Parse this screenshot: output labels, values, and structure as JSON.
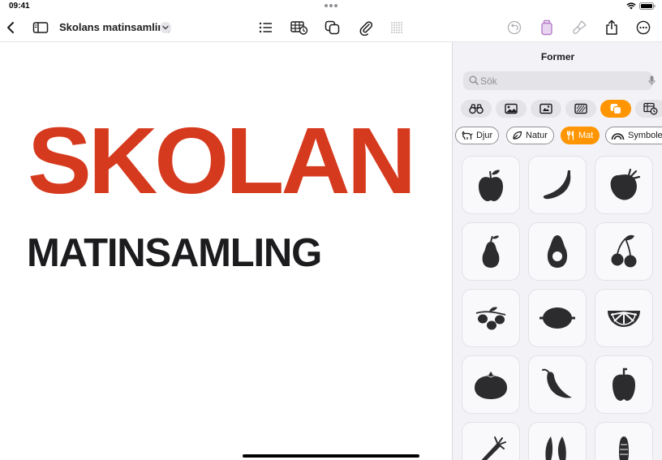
{
  "status_bar": {
    "time": "09:41"
  },
  "toolbar": {
    "doc_title": "Skolans matinsamling",
    "icons": [
      "back-chevron-icon",
      "sidebar-icon",
      "title-menu-chevron-icon",
      "list-icon",
      "table-icon",
      "shapes-icon",
      "attachment-icon",
      "grid-icon",
      "undo-icon",
      "format-icon",
      "brush-icon",
      "share-icon",
      "more-icon"
    ]
  },
  "canvas": {
    "title_text": "SKOLAN",
    "subtitle_text": "MATINSAMLING",
    "title_color": "#d63a1e",
    "subtitle_color": "#1c1c1e"
  },
  "panel": {
    "title": "Former",
    "search": {
      "placeholder": "Sök",
      "value": ""
    },
    "categories": [
      "binoculars-icon",
      "photo-icon",
      "media-icon",
      "texture-icon",
      "shapes-icon",
      "table-icon"
    ],
    "active_category": 4,
    "chips": [
      {
        "label": "Djur",
        "icon": "animal-icon",
        "active": false
      },
      {
        "label": "Natur",
        "icon": "leaf-icon",
        "active": false
      },
      {
        "label": "Mat",
        "icon": "fork-knife-icon",
        "active": true
      },
      {
        "label": "Symboler",
        "icon": "rainbow-icon",
        "active": false
      }
    ],
    "shapes": [
      "apple",
      "banana",
      "strawberry",
      "pear",
      "avocado",
      "cherries",
      "olives",
      "lemon",
      "orange-slice",
      "tomato",
      "chili-pepper",
      "bell-pepper",
      "carrot",
      "pea-pods",
      "corn"
    ],
    "accent_color": "#ff9500"
  }
}
